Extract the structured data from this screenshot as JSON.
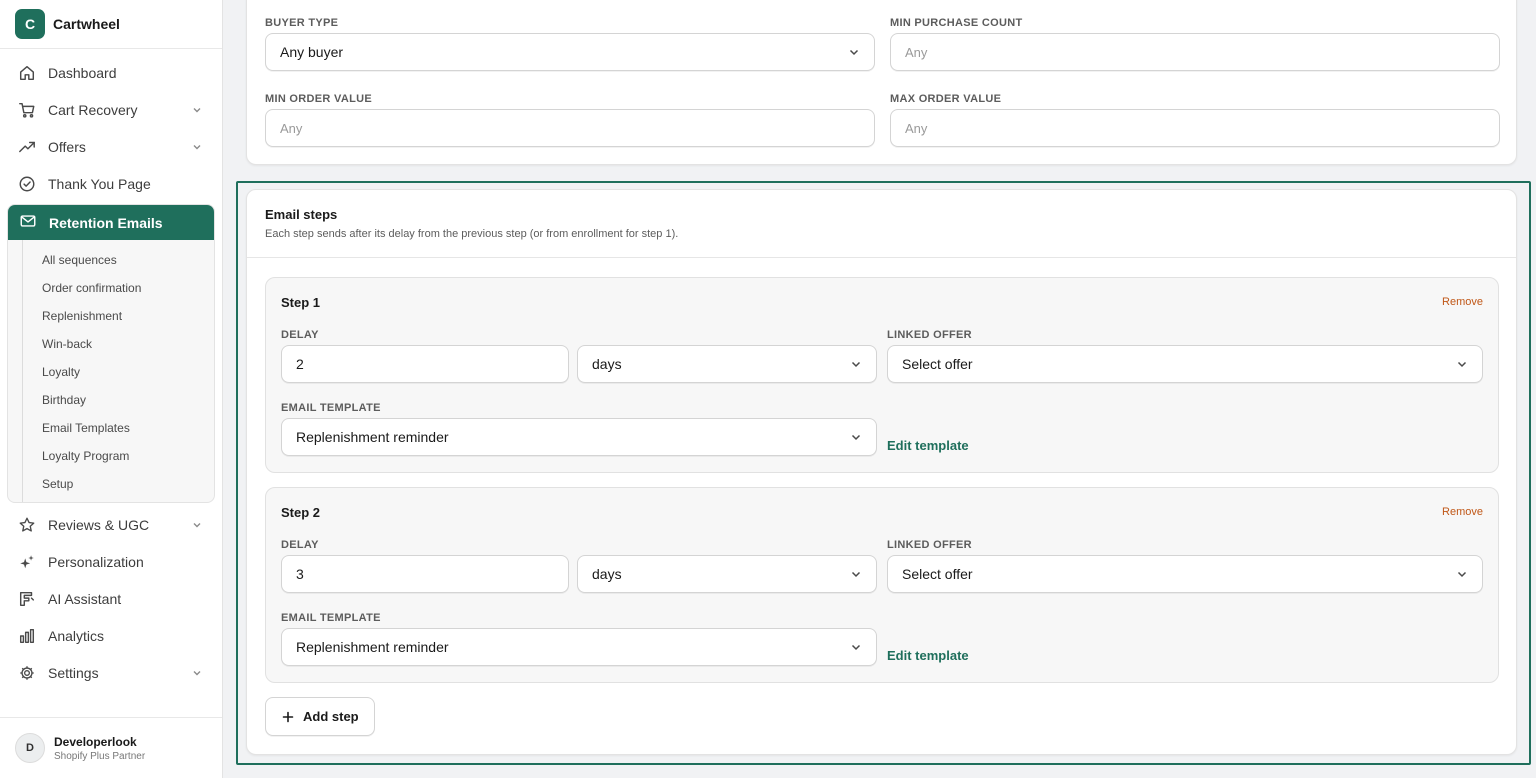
{
  "brand": {
    "logo_letter": "C",
    "name": "Cartwheel",
    "accent": "#1f6f5c"
  },
  "nav": {
    "items_top": [
      {
        "label": "Dashboard",
        "icon": "home-icon"
      },
      {
        "label": "Cart Recovery",
        "icon": "cart-icon",
        "expandable": true
      },
      {
        "label": "Offers",
        "icon": "trending-up-icon",
        "expandable": true
      },
      {
        "label": "Thank You Page",
        "icon": "check-circle-icon"
      }
    ],
    "active": {
      "label": "Retention Emails",
      "icon": "mail-icon"
    },
    "sub_items": [
      "All sequences",
      "Order confirmation",
      "Replenishment",
      "Win-back",
      "Loyalty",
      "Birthday",
      "Email Templates",
      "Loyalty Program",
      "Setup"
    ],
    "items_bottom": [
      {
        "label": "Reviews & UGC",
        "icon": "star-icon",
        "expandable": true
      },
      {
        "label": "Personalization",
        "icon": "sparkle-icon"
      },
      {
        "label": "AI Assistant",
        "icon": "assistant-icon"
      },
      {
        "label": "Analytics",
        "icon": "bar-chart-icon"
      },
      {
        "label": "Settings",
        "icon": "gear-icon",
        "expandable": true
      }
    ]
  },
  "user": {
    "initial": "D",
    "name": "Developerlook",
    "role": "Shopify Plus Partner"
  },
  "filters": {
    "buyer_type": {
      "label": "BUYER TYPE",
      "value": "Any buyer"
    },
    "min_purchase_count": {
      "label": "MIN PURCHASE COUNT",
      "placeholder": "Any"
    },
    "min_order_value": {
      "label": "MIN ORDER VALUE",
      "placeholder": "Any"
    },
    "max_order_value": {
      "label": "MAX ORDER VALUE",
      "placeholder": "Any"
    }
  },
  "email_steps": {
    "title": "Email steps",
    "description": "Each step sends after its delay from the previous step (or from enrollment for step 1).",
    "remove_label": "Remove",
    "delay_label": "DELAY",
    "linked_offer_label": "LINKED OFFER",
    "email_template_label": "EMAIL TEMPLATE",
    "edit_template_label": "Edit template",
    "add_step_label": "Add step",
    "steps": [
      {
        "title": "Step 1",
        "delay": "2",
        "unit": "days",
        "offer": "Select offer",
        "template": "Replenishment reminder"
      },
      {
        "title": "Step 2",
        "delay": "3",
        "unit": "days",
        "offer": "Select offer",
        "template": "Replenishment reminder"
      }
    ]
  }
}
